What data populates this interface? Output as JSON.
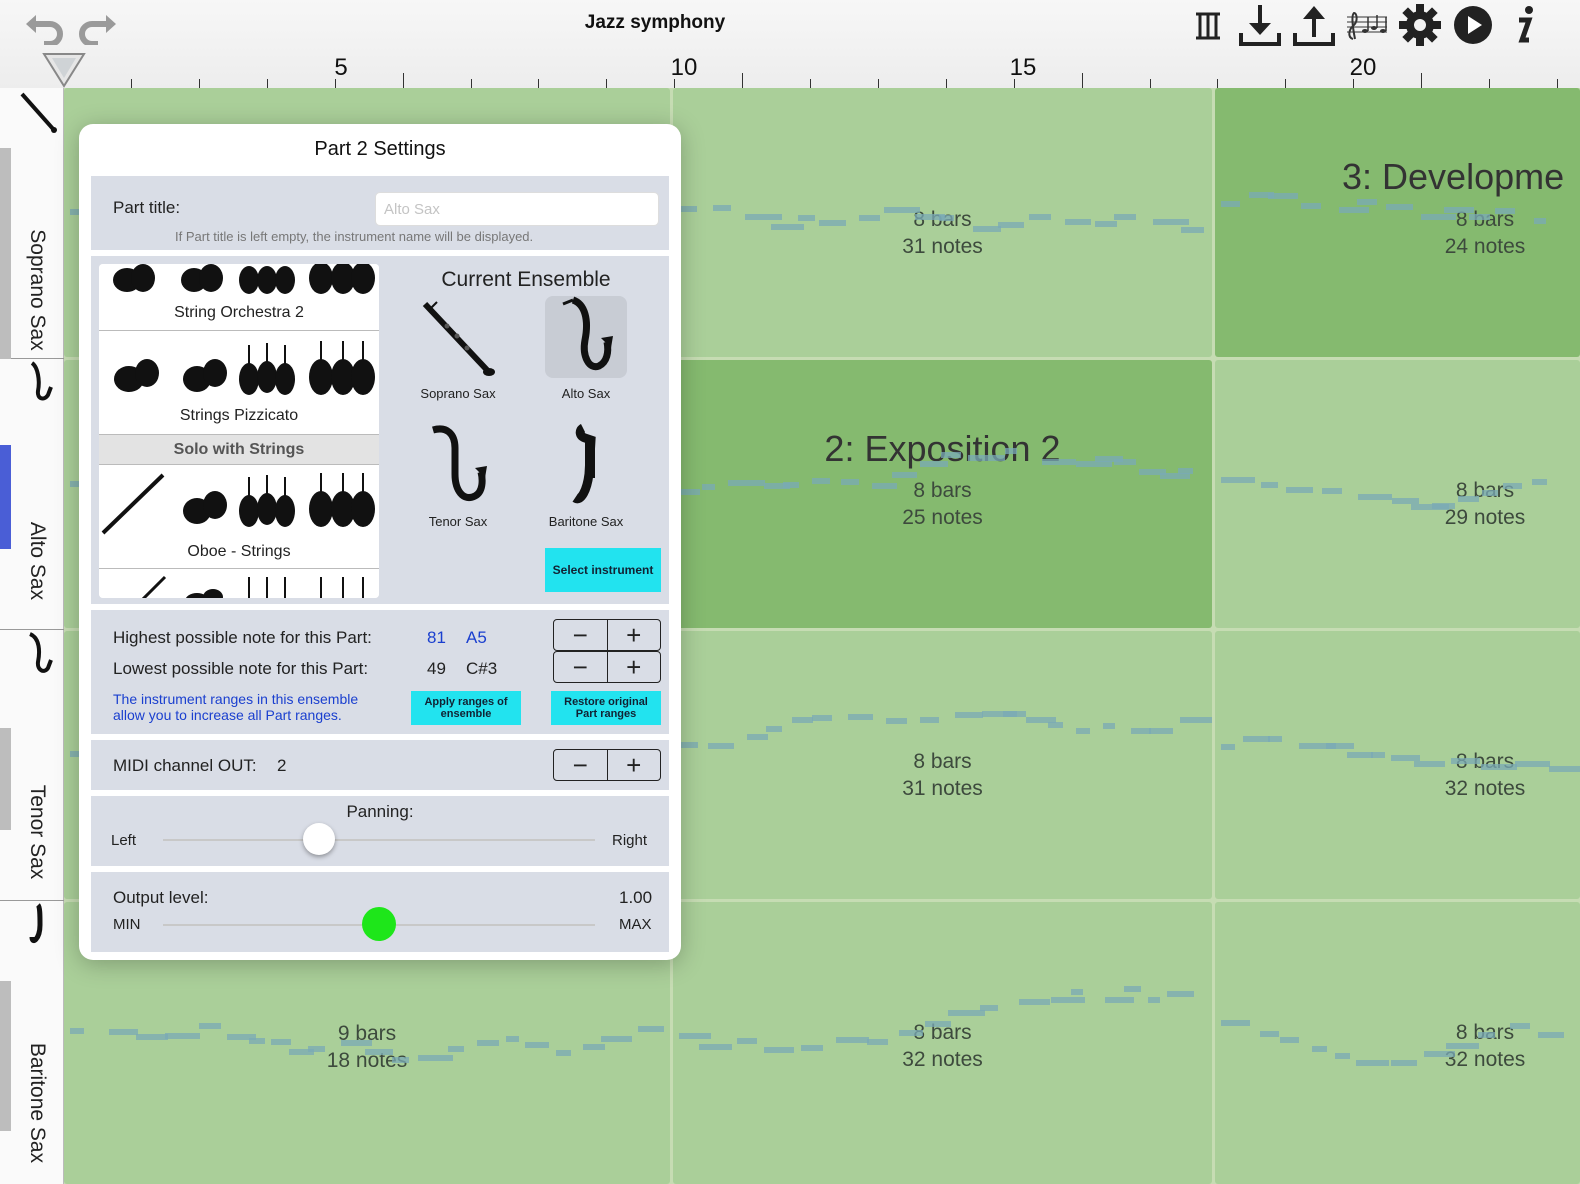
{
  "app": {
    "title": "Jazz symphony"
  },
  "toolbar": {
    "icons": [
      "undo-icon",
      "redo-icon",
      "mixer-icon",
      "download-icon",
      "upload-icon",
      "score-icon",
      "gear-icon",
      "play-icon",
      "info-icon"
    ]
  },
  "ruler": {
    "labels": [
      "5",
      "10",
      "15",
      "20"
    ]
  },
  "tracks": [
    {
      "name": "Soprano Sax",
      "active": false
    },
    {
      "name": "Alto Sax",
      "active": true
    },
    {
      "name": "Tenor Sax",
      "active": false
    },
    {
      "name": "Baritone Sax",
      "active": false
    }
  ],
  "sections": {
    "exposition2": "2: Exposition 2",
    "development": "3: Developme"
  },
  "cells": {
    "r0c1": {
      "bars": "8 bars",
      "notes": "31 notes"
    },
    "r0c2": {
      "bars": "8 bars",
      "notes": "24 notes"
    },
    "r1c1": {
      "bars": "8 bars",
      "notes": "25 notes"
    },
    "r1c2": {
      "bars": "8 bars",
      "notes": "29 notes"
    },
    "r2c1": {
      "bars": "8 bars",
      "notes": "31 notes"
    },
    "r2c2": {
      "bars": "8 bars",
      "notes": "32 notes"
    },
    "r3c0": {
      "bars": "9 bars",
      "notes": "18 notes"
    },
    "r3c1": {
      "bars": "8 bars",
      "notes": "32 notes"
    },
    "r3c2": {
      "bars": "8 bars",
      "notes": "32 notes"
    }
  },
  "dialog": {
    "title": "Part 2 Settings",
    "part_title": {
      "label": "Part title:",
      "value": "",
      "placeholder": "Alto Sax",
      "hint": "If Part title is left empty, the instrument name will be displayed."
    },
    "ensembles": {
      "items": [
        "String Orchestra 2",
        "Strings Pizzicato",
        "Oboe - Strings"
      ],
      "header": "Solo with Strings"
    },
    "current_ensemble": {
      "heading": "Current Ensemble",
      "instruments": [
        "Soprano Sax",
        "Alto Sax",
        "Tenor Sax",
        "Baritone Sax"
      ],
      "selected": "Alto Sax",
      "select_button": "Select instrument"
    },
    "range": {
      "highest_label": "Highest possible note for this Part:",
      "highest_value": "81",
      "highest_note": "A5",
      "lowest_label": "Lowest possible note for this Part:",
      "lowest_value": "49",
      "lowest_note": "C#3",
      "info_line1": "The instrument ranges in this ensemble",
      "info_line2": "allow you to increase all Part ranges.",
      "apply_line1": "Apply ranges of",
      "apply_line2": "ensemble",
      "restore_line1": "Restore original",
      "restore_line2": "Part ranges"
    },
    "midi": {
      "label": "MIDI channel OUT:",
      "value": "2"
    },
    "panning": {
      "label": "Panning:",
      "left": "Left",
      "right": "Right",
      "position": 0.36
    },
    "output": {
      "label": "Output level:",
      "value": "1.00",
      "min": "MIN",
      "max": "MAX",
      "position": 0.5
    }
  },
  "colors": {
    "accent_cyan": "#22e3ef",
    "active_track": "#4a5ed6",
    "level_thumb": "#1ee61a",
    "range_blue": "#1a3fcf"
  }
}
